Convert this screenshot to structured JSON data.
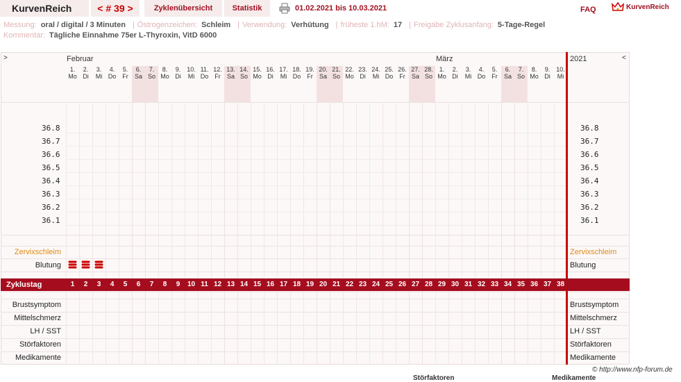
{
  "header": {
    "brand": "KurvenReich",
    "cycle_nav": "< # 39 >",
    "overview": "Zyklenübersicht",
    "statistics": "Statistik",
    "date_range": "01.02.2021 bis 10.03.2021",
    "faq": "FAQ",
    "logo_text": "KurvenReich"
  },
  "info": {
    "messung_label": "Messung:",
    "messung_value": "oral / digital / 3 Minuten",
    "oestrogen_label": "Östrogenzeichen:",
    "oestrogen_value": "Schleim",
    "verwendung_label": "Verwendung:",
    "verwendung_value": "Verhütung",
    "hm_label": "früheste 1.hM:",
    "hm_value": "17",
    "freigabe_label": "Freigabe Zyklusanfang:",
    "freigabe_value": "5-Tage-Regel",
    "kommentar_label": "Kommentar:",
    "kommentar_value": "Tägliche Einnahme 75er L-Thyroxin, VitD 6000"
  },
  "chart": {
    "left_arrow": ">",
    "right_arrow": "<",
    "month1": "Februar",
    "month2": "März",
    "year": "2021",
    "days": [
      {
        "d": "1.",
        "w": "Mo"
      },
      {
        "d": "2.",
        "w": "Di"
      },
      {
        "d": "3.",
        "w": "Mi"
      },
      {
        "d": "4.",
        "w": "Do"
      },
      {
        "d": "5.",
        "w": "Fr"
      },
      {
        "d": "6.",
        "w": "Sa"
      },
      {
        "d": "7.",
        "w": "So"
      },
      {
        "d": "8.",
        "w": "Mo"
      },
      {
        "d": "9.",
        "w": "Di"
      },
      {
        "d": "10.",
        "w": "Mi"
      },
      {
        "d": "11.",
        "w": "Do"
      },
      {
        "d": "12.",
        "w": "Fr"
      },
      {
        "d": "13.",
        "w": "Sa"
      },
      {
        "d": "14.",
        "w": "So"
      },
      {
        "d": "15.",
        "w": "Mo"
      },
      {
        "d": "16.",
        "w": "Di"
      },
      {
        "d": "17.",
        "w": "Mi"
      },
      {
        "d": "18.",
        "w": "Do"
      },
      {
        "d": "19.",
        "w": "Fr"
      },
      {
        "d": "20.",
        "w": "Sa"
      },
      {
        "d": "21.",
        "w": "So"
      },
      {
        "d": "22.",
        "w": "Mo"
      },
      {
        "d": "23.",
        "w": "Di"
      },
      {
        "d": "24.",
        "w": "Mi"
      },
      {
        "d": "25.",
        "w": "Do"
      },
      {
        "d": "26.",
        "w": "Fr"
      },
      {
        "d": "27.",
        "w": "Sa"
      },
      {
        "d": "28.",
        "w": "So"
      },
      {
        "d": "1.",
        "w": "Mo"
      },
      {
        "d": "2.",
        "w": "Di"
      },
      {
        "d": "3.",
        "w": "Mi"
      },
      {
        "d": "4.",
        "w": "Do"
      },
      {
        "d": "5.",
        "w": "Fr"
      },
      {
        "d": "6.",
        "w": "Sa"
      },
      {
        "d": "7.",
        "w": "So"
      },
      {
        "d": "8.",
        "w": "Mo"
      },
      {
        "d": "9.",
        "w": "Di"
      },
      {
        "d": "10.",
        "w": "Mi"
      }
    ],
    "temps": [
      "36.8",
      "36.7",
      "36.6",
      "36.5",
      "36.4",
      "36.3",
      "36.2",
      "36.1"
    ],
    "rows": {
      "cervical": "Zervixschleim",
      "bleeding": "Blutung",
      "cycle_day": "Zyklustag",
      "breast": "Brustsymptom",
      "midpain": "Mittelschmerz",
      "lh": "LH / SST",
      "disturb": "Störfaktoren",
      "meds": "Medikamente"
    },
    "bleeding_days": [
      1,
      2,
      3
    ],
    "colors": {
      "accent": "#a50d1e",
      "redline": "#cc0000",
      "weekend": "#f3e1e1",
      "orange": "#e08a10"
    }
  },
  "footer": {
    "copyright": "© http://www.nfp-forum.de",
    "below1": "Störfaktoren",
    "below2": "Medikamente"
  }
}
